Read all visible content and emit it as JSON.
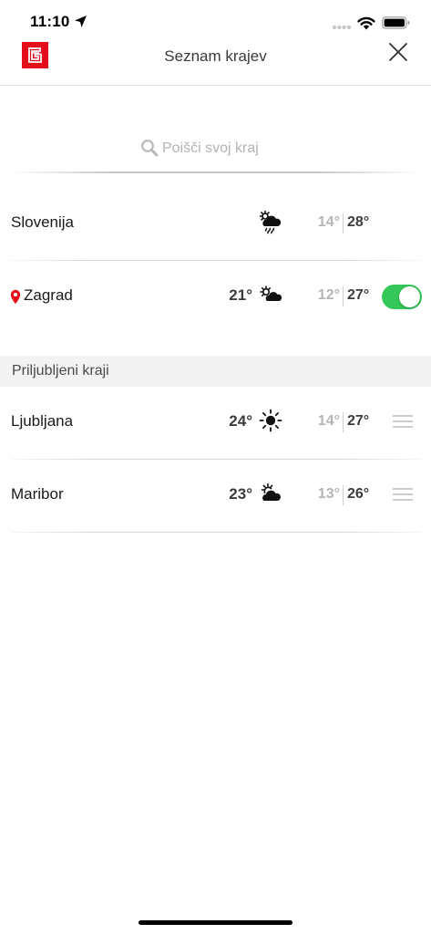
{
  "status": {
    "time": "11:10"
  },
  "header": {
    "title": "Seznam krajev",
    "logo_color": "#e3101b"
  },
  "search": {
    "placeholder": "Poišči svoj kraj",
    "value": ""
  },
  "locations": [
    {
      "name": "Slovenija",
      "current": "",
      "icon": "sun-cloud-rain-icon",
      "min": "14°",
      "max": "28°"
    },
    {
      "name": "Zagrad",
      "current": "21°",
      "icon": "sun-cloud-icon",
      "min": "12°",
      "max": "27°",
      "location_pin": true,
      "toggle_on": true
    }
  ],
  "favorites": {
    "title": "Priljubljeni kraji",
    "items": [
      {
        "name": "Ljubljana",
        "current": "24°",
        "icon": "sun-icon",
        "min": "14°",
        "max": "27°"
      },
      {
        "name": "Maribor",
        "current": "23°",
        "icon": "sun-cloud-icon",
        "min": "13°",
        "max": "26°"
      }
    ]
  },
  "colors": {
    "accent_red": "#e3101b",
    "toggle_green": "#34c759",
    "muted_text": "#b5b5b5"
  }
}
